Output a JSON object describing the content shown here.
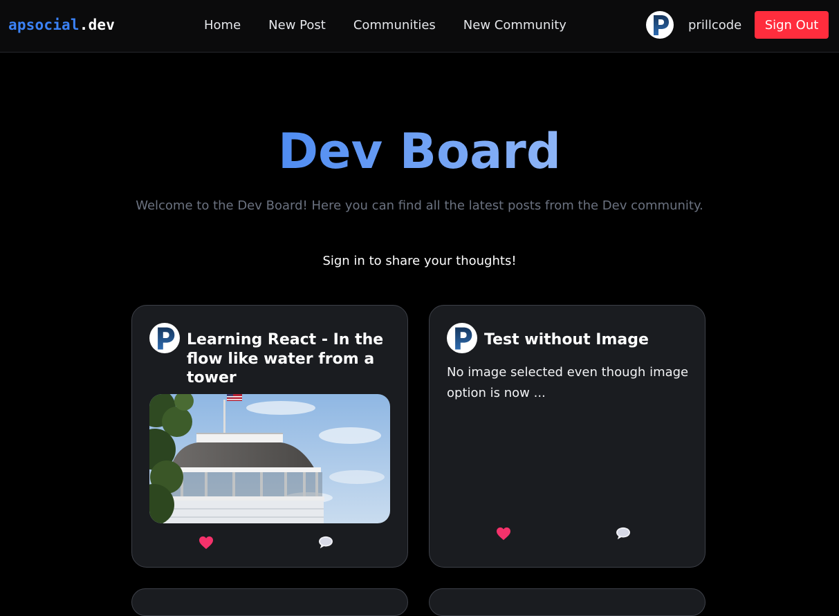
{
  "navbar": {
    "brand_part1": "apsocial",
    "brand_part2": ".dev",
    "links": [
      {
        "label": "Home"
      },
      {
        "label": "New Post"
      },
      {
        "label": "Communities"
      },
      {
        "label": "New Community"
      }
    ],
    "avatar_icon": "p-logo-avatar",
    "username": "prillcode",
    "signout_label": "Sign Out",
    "signout_color": "#ff2d3d"
  },
  "hero": {
    "title": "Dev Board",
    "subtitle": "Welcome to the Dev Board! Here you can find all the latest posts from the Dev community.",
    "signin_message": "Sign in to share your thoughts!",
    "title_gradient": [
      "#4f8cf2",
      "#8eb5f7"
    ]
  },
  "posts": [
    {
      "title": "Learning React - In the flow like water from a tower",
      "has_image": true,
      "image_subject": "white water tower with flag",
      "like_icon": "heart-icon",
      "comment_icon": "speech-bubble-icon"
    },
    {
      "title": "Test without Image",
      "excerpt": "No image selected even though image option is now ...",
      "has_image": false,
      "like_icon": "heart-icon",
      "comment_icon": "speech-bubble-icon"
    }
  ]
}
